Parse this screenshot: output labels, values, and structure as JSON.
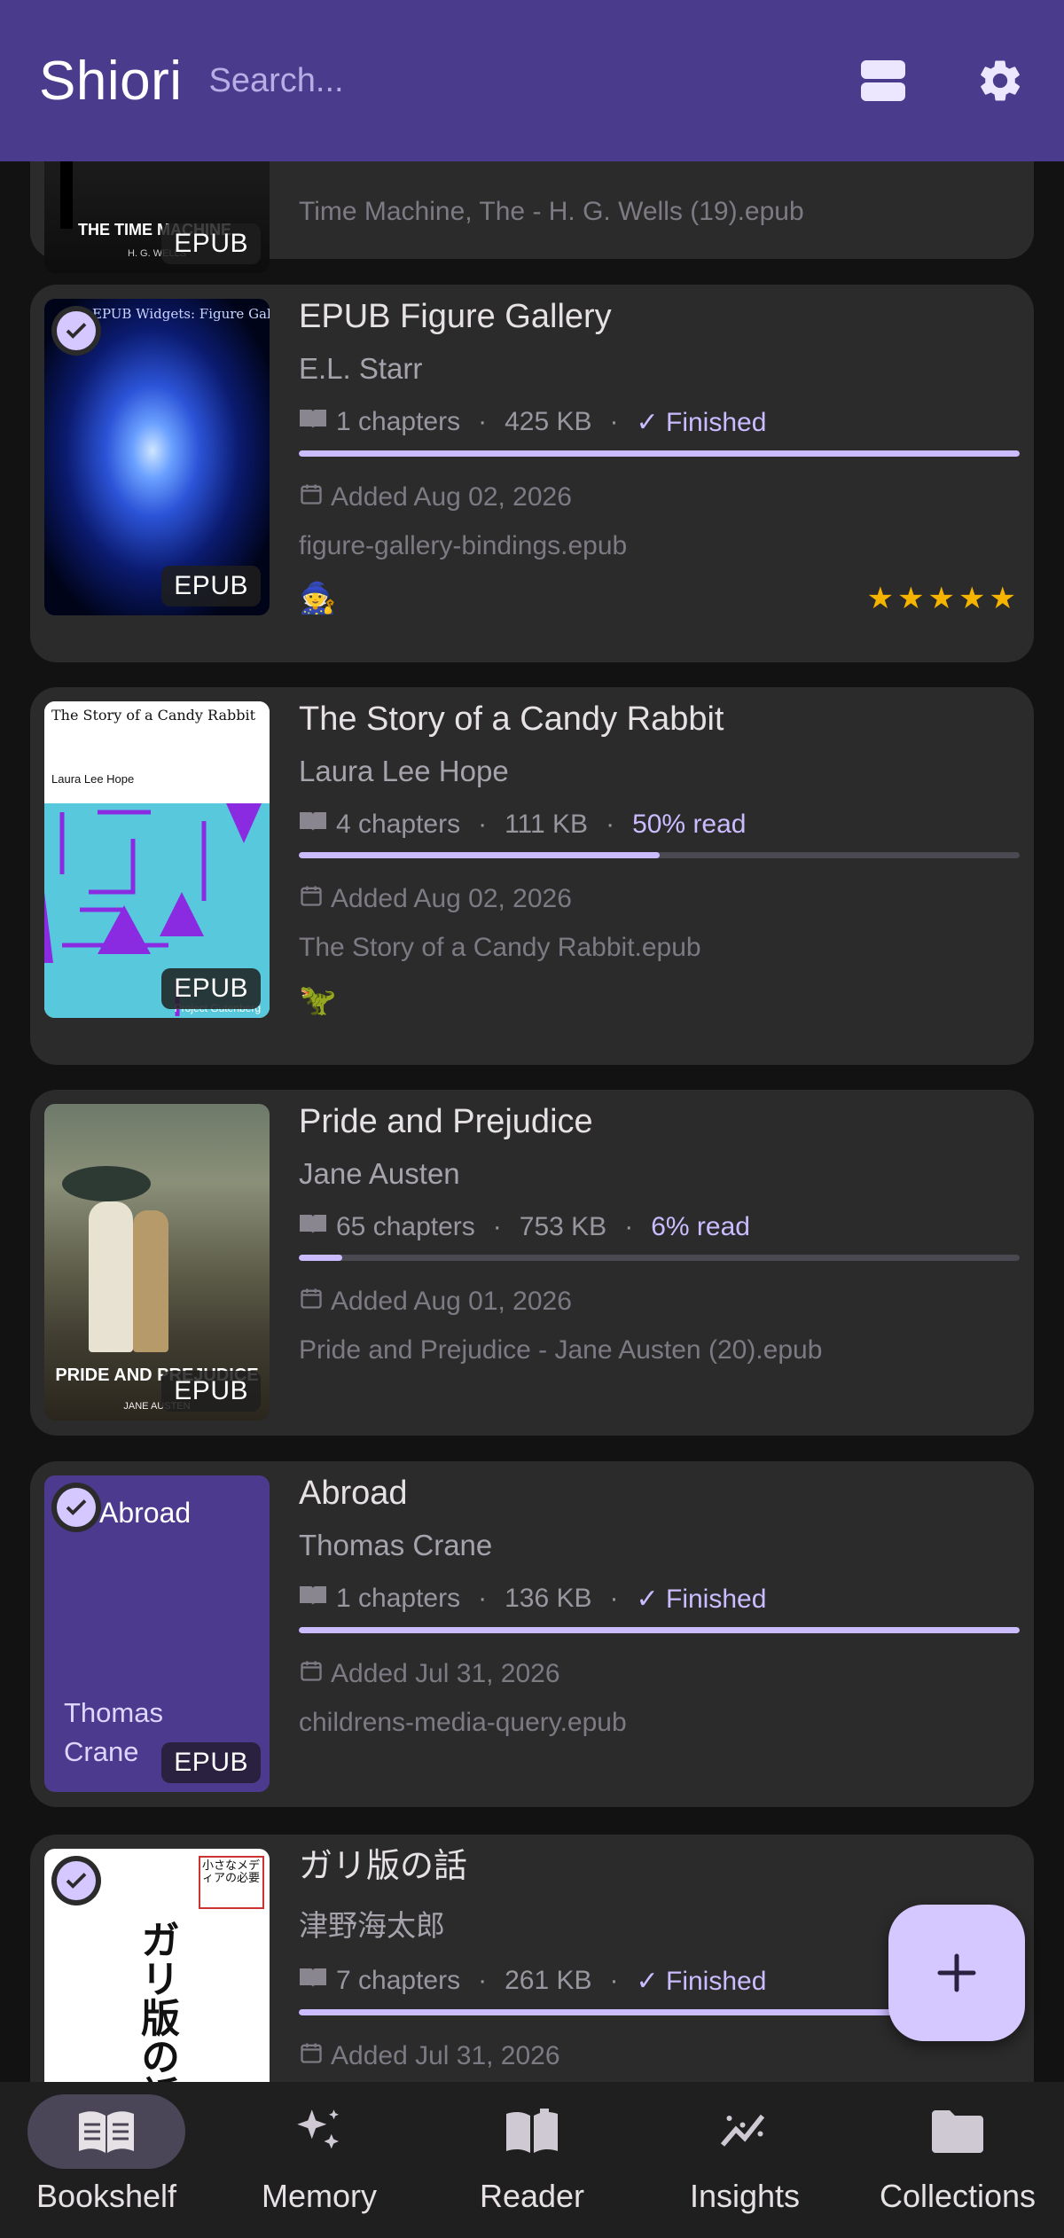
{
  "header": {
    "title": "Shiori",
    "search_placeholder": "Search..."
  },
  "books": [
    {
      "title": "",
      "author": "",
      "file": "Time Machine, The - H. G. Wells (19).epub",
      "badge": "EPUB",
      "cover_text": "THE TIME MACHINE",
      "cover_subtext": "H. G. WELLS"
    },
    {
      "title": "EPUB Figure Gallery",
      "author": "E.L. Starr",
      "chapters": "1 chapters",
      "size": "425 KB",
      "status": "✓ Finished",
      "progress": 1.0,
      "added": "Added Aug 02, 2026",
      "file": "figure-gallery-bindings.epub",
      "badge": "EPUB",
      "cover_text": "EPUB Widgets: Figure Gallery",
      "emoji": "🧙",
      "stars": "★★★★★",
      "selected": true
    },
    {
      "title": "The Story of a Candy Rabbit",
      "author": "Laura Lee Hope",
      "chapters": "4 chapters",
      "size": "111 KB",
      "status": "50% read",
      "progress": 0.5,
      "added": "Added Aug 02, 2026",
      "file": "The Story of a Candy Rabbit.epub",
      "badge": "EPUB",
      "cover_text": "The Story of a Candy Rabbit",
      "cover_author": "Laura Lee Hope",
      "cover_footer": "Project Gutenberg",
      "emoji": "🦖"
    },
    {
      "title": "Pride and Prejudice",
      "author": "Jane Austen",
      "chapters": "65 chapters",
      "size": "753 KB",
      "status": "6% read",
      "progress": 0.06,
      "added": "Added Aug 01, 2026",
      "file": "Pride and Prejudice - Jane Austen (20).epub",
      "badge": "EPUB",
      "cover_text": "PRIDE AND PREJUDICE",
      "cover_author": "JANE AUSTEN"
    },
    {
      "title": "Abroad",
      "author": "Thomas Crane",
      "chapters": "1 chapters",
      "size": "136 KB",
      "status": "✓ Finished",
      "progress": 1.0,
      "added": "Added Jul 31, 2026",
      "file": "childrens-media-query.epub",
      "badge": "EPUB",
      "cover_text": "Abroad",
      "cover_author": "Thomas Crane",
      "selected": true
    },
    {
      "title": "ガリ版の話",
      "author": "津野海太郎",
      "chapters": "7 chapters",
      "size": "261 KB",
      "status": "✓ Finished",
      "progress": 1.0,
      "added": "Added Jul 31, 2026",
      "badge": "EPUB",
      "cover_text": "ガリ版の話",
      "cover_subtext": "小さなメディアの必要",
      "selected": true
    }
  ],
  "fab": {
    "icon": "plus-icon"
  },
  "nav": [
    {
      "label": "Bookshelf",
      "icon": "book-open-icon",
      "active": true
    },
    {
      "label": "Memory",
      "icon": "sparkles-icon"
    },
    {
      "label": "Reader",
      "icon": "reader-book-icon"
    },
    {
      "label": "Insights",
      "icon": "trend-chart-icon"
    },
    {
      "label": "Collections",
      "icon": "folder-icon"
    }
  ],
  "colors": {
    "header": "#4a3b8c",
    "accent": "#cbbcff",
    "card": "#2b2b2b",
    "background": "#121212",
    "stars": "#f4b400"
  }
}
